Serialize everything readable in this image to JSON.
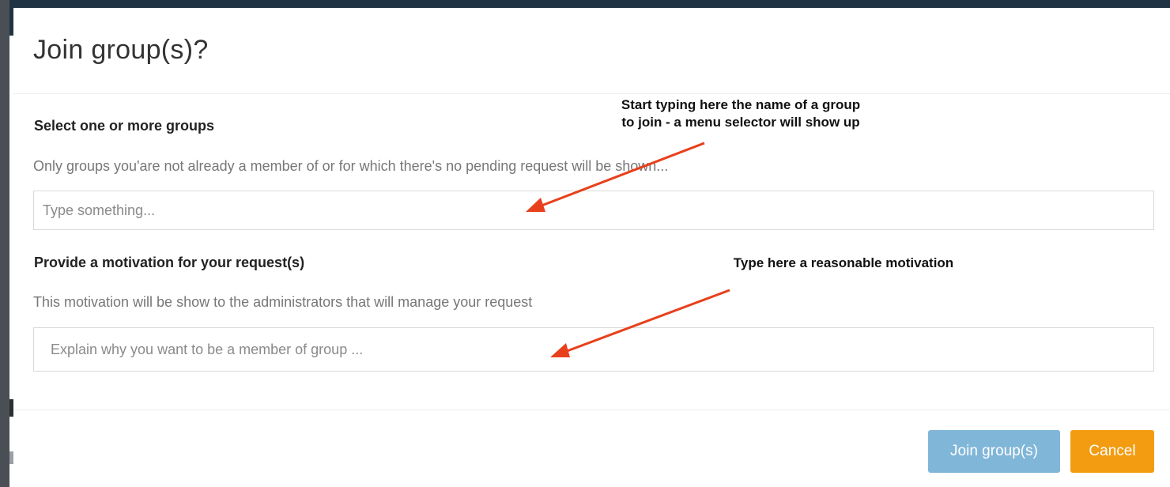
{
  "dialog": {
    "title": "Join group(s)?"
  },
  "groups": {
    "label": "Select one or more groups",
    "help": "Only groups you'are not already a member of or for which there's no pending request will be shown...",
    "input_placeholder": "Type something..."
  },
  "motivation": {
    "label": "Provide a motivation for your request(s)",
    "help": "This motivation will be show to the administrators that will manage your request",
    "input_placeholder": "Explain why you want to be a member of group ..."
  },
  "annotations": {
    "groups_line1": "Start typing here the name of a group",
    "groups_line2": "to join - a menu selector will show up",
    "motivation": "Type here a reasonable motivation",
    "arrow_color": "#e8401c"
  },
  "footer": {
    "join_label": "Join group(s)",
    "cancel_label": "Cancel"
  },
  "colors": {
    "join_button": "#80b6d8",
    "cancel_button": "#f39c12",
    "header_bar": "#1f3344"
  }
}
